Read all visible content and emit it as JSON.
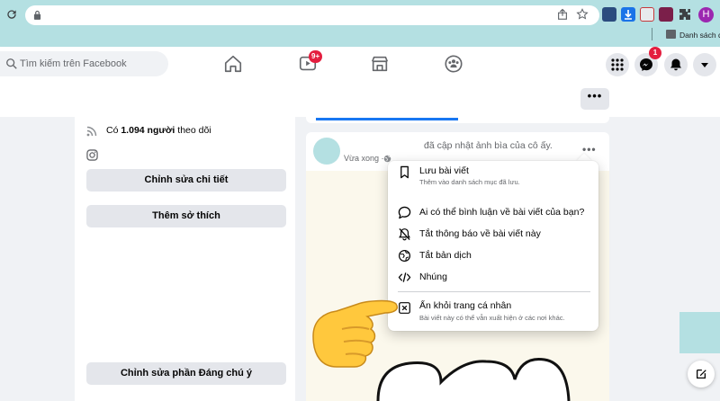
{
  "browser": {
    "bookmark_label": "Danh sách đ",
    "profile_initial": "H"
  },
  "facebook": {
    "search_placeholder": "Tìm kiếm trên Facebook",
    "watch_badge": "9+",
    "messenger_badge": "1"
  },
  "profile": {
    "followers_prefix": "Có ",
    "followers_count": "1.094 người",
    "followers_suffix": " theo dõi",
    "edit_details_label": "Chỉnh sửa chi tiết",
    "add_hobbies_label": "Thêm sở thích",
    "edit_featured_label": "Chỉnh sửa phần Đáng chú ý",
    "more_label": "•••"
  },
  "post": {
    "title": "đã cập nhật ảnh bìa của cô ấy.",
    "time": "Vừa xong ·",
    "more_label": "•••"
  },
  "menu": {
    "items": [
      {
        "label": "Lưu bài viết",
        "sub": "Thêm vào danh sách mục đã lưu.",
        "icon": "bookmark-icon"
      },
      {
        "label": "Ai có thể bình luận về bài viết của bạn?",
        "icon": "comment-icon"
      },
      {
        "label": "Tắt thông báo về bài viết này",
        "icon": "bell-off-icon"
      },
      {
        "label": "Tắt bản dịch",
        "icon": "globe-icon"
      },
      {
        "label": "Nhúng",
        "icon": "code-icon"
      },
      {
        "label": "Ẩn khỏi trang cá nhân",
        "sub": "Bài viết này có thể vẫn xuất hiện ở các nơi khác.",
        "icon": "hide-box-icon"
      }
    ]
  },
  "colors": {
    "chrome_teal": "#b4e0e2",
    "fb_blue": "#1877f2",
    "badge_red": "#e41e3f",
    "hand_yellow": "#ffc83d"
  }
}
